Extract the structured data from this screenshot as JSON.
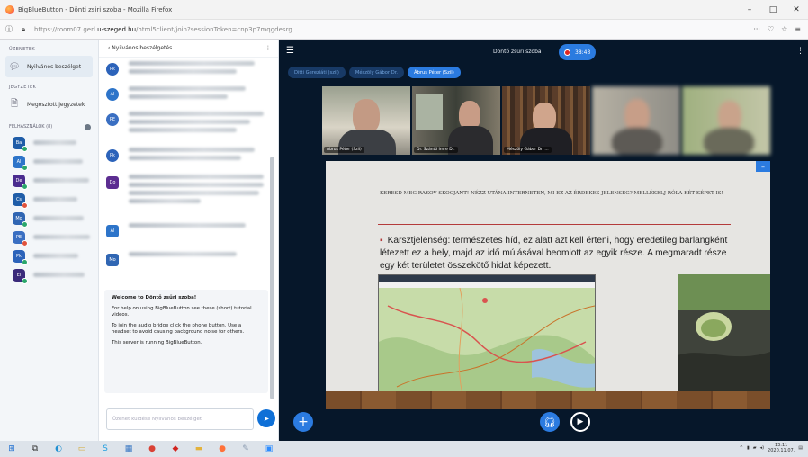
{
  "browser": {
    "title": "BigBlueButton - Dönti zsiri szoba - Mozilla Firefox",
    "url_prefix": "https://room07.gerl.",
    "url_domain": "u-szeged.hu",
    "url_rest": "/html5client/join?sessionToken=cnp3p7mqgdesrg",
    "controls": {
      "minimize": "–",
      "maximize": "□",
      "close": "✕"
    },
    "toolbar_icons": [
      "···",
      "♡",
      "☆",
      "≡"
    ]
  },
  "leftnav": {
    "messages_head": "ÜZENETEK",
    "public_chat": "Nyilvános beszélget",
    "notes_head": "JEGYZETEK",
    "shared_notes": "Megosztott jegyzetek",
    "users_head": "FELHASZNÁLÓK (8)",
    "users": [
      {
        "initials": "Ba",
        "color": "#1f5da8",
        "status": "#2aa66b"
      },
      {
        "initials": "Al",
        "color": "#2d74c9",
        "status": "#2aa66b"
      },
      {
        "initials": "De",
        "color": "#4a2c8f",
        "status": "#2aa66b"
      },
      {
        "initials": "Cs",
        "color": "#1f5da8",
        "status": "#e0533d"
      },
      {
        "initials": "Mo",
        "color": "#3066b3",
        "status": "#2aa66b"
      },
      {
        "initials": "PE",
        "color": "#3a6fc2",
        "status": "#e0533d"
      },
      {
        "initials": "Pk",
        "color": "#2c63ba",
        "status": "#2aa66b"
      },
      {
        "initials": "El",
        "color": "#3a2a7a",
        "status": "#2aa66b"
      }
    ]
  },
  "chat": {
    "title": "‹  Nyilvános beszélgetés",
    "messages": [
      {
        "initials": "Pk",
        "color": "#2c63ba",
        "lines": [
          140,
          120
        ]
      },
      {
        "initials": "Al",
        "color": "#2d74c9",
        "lines": [
          130,
          110
        ]
      },
      {
        "initials": "PE",
        "color": "#3a6fc2",
        "lines": [
          150,
          135,
          120
        ]
      },
      {
        "initials": "Pk",
        "color": "#2c63ba",
        "lines": [
          140,
          125
        ]
      },
      {
        "initials": "Do",
        "color": "#5c2d91",
        "lines": [
          150,
          150,
          145,
          80
        ]
      },
      {
        "initials": "Al",
        "color": "#2d74c9",
        "lines": [
          130
        ]
      },
      {
        "initials": "Mo",
        "color": "#3066b3",
        "lines": [
          120
        ]
      }
    ],
    "welcome_title": "Welcome to Döntő zsűri szoba!",
    "welcome_help": "For help on using BigBlueButton see these (short) tutorial videos.",
    "welcome_audio": "To join the audio bridge click the phone button. Use a headset to avoid causing background noise for others.",
    "welcome_server": "This server is running BigBlueButton.",
    "placeholder": "Üzenet küldése Nyilvános beszélget"
  },
  "main": {
    "conference_name": "Döntő zsűri szoba",
    "recording_time": "38:43",
    "talkers": [
      "Ditti Gereziáti (szil)",
      "Mészöly Gábor Dr.",
      "Ábrus Péter (Szil)"
    ],
    "videos": [
      {
        "name": "Ábrus Péter (Szil)"
      },
      {
        "name": "Dr. Szántó Imre Dr."
      },
      {
        "name": "Mészöly Gábor Dr. ..."
      },
      {
        "name": ""
      },
      {
        "name": ""
      }
    ]
  },
  "slide": {
    "heading": "KERESD MEG RAKOV SKOCJANT! NÉZZ UTÁNA INTERNETEN, MI EZ AZ ÉRDEKES JELENSÉG? MELLÉKELJ RÓLA KÉT KÉPET IS!",
    "bullet": "Karsztjelenség: természetes híd, ez alatt azt kell érteni, hogy eredetileg barlangként létezett ez a hely, majd az idő múlásával beomlott az egyik része.  A megmaradt része egy két területet összekötő hidat képezett."
  },
  "taskbar": {
    "time": "13:11",
    "date": "2020.11.07."
  }
}
